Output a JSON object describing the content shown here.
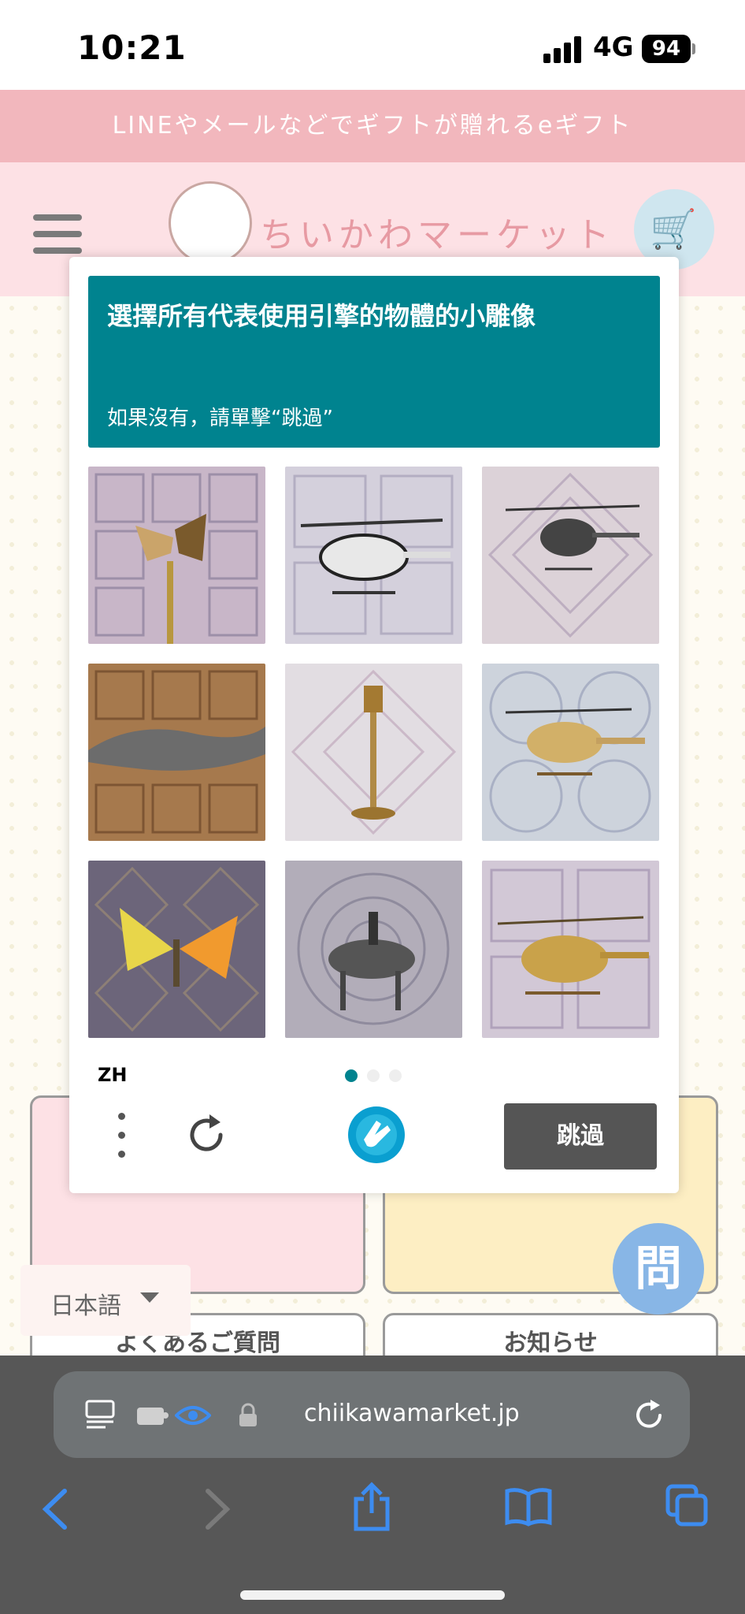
{
  "status_bar": {
    "time": "10:21",
    "network": "4G",
    "battery": "94"
  },
  "site": {
    "banner": "LINEやメールなどでギフトが贈れるeギフト",
    "logo_text": "ちいかわマーケット",
    "cards": [
      {
        "label": "よくあるご質問"
      },
      {
        "label": "お知らせ"
      }
    ],
    "language": "日本語",
    "help_button": "問"
  },
  "captcha": {
    "prompt_title": "選擇所有代表使用引擎的物體的小雕像",
    "prompt_sub": "如果沒有，請單擊“跳過”",
    "tiles": [
      {
        "subject": "butterfly"
      },
      {
        "subject": "helicopter"
      },
      {
        "subject": "helicopter"
      },
      {
        "subject": "crocodile"
      },
      {
        "subject": "street lamp"
      },
      {
        "subject": "helicopter"
      },
      {
        "subject": "butterfly"
      },
      {
        "subject": "horse with rider"
      },
      {
        "subject": "helicopter"
      }
    ],
    "language_code": "ZH",
    "page_indicator": {
      "current": 1,
      "total": 3
    },
    "skip_label": "跳過",
    "colors": {
      "prompt_bg": "#00838f",
      "button_bg": "#555555",
      "active_dot": "#00838f"
    }
  },
  "browser": {
    "url": "chiikawamarket.jp",
    "icons": [
      "reader-icon",
      "extension-icon",
      "eye-icon",
      "lock-icon",
      "reload-icon",
      "back-icon",
      "forward-icon",
      "share-icon",
      "bookmarks-icon",
      "tabs-icon"
    ]
  }
}
